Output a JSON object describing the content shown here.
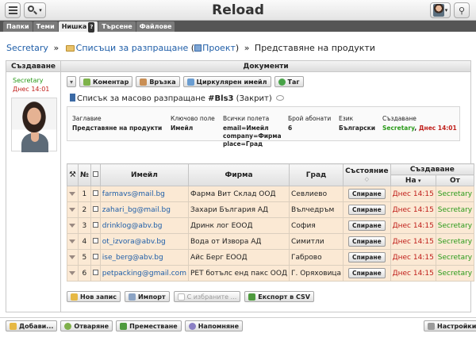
{
  "app": {
    "title": "Reload"
  },
  "tabs": [
    {
      "label": "Папки"
    },
    {
      "label": "Теми"
    },
    {
      "label": "Нишка",
      "badge": "?"
    },
    {
      "label": "Търсене"
    },
    {
      "label": "Файлове"
    }
  ],
  "breadcrumb": {
    "root": "Secretary",
    "sep1": "»",
    "lists": "Списъци за разпращане",
    "open_paren": " (",
    "project": "Проект",
    "close_paren": ")",
    "sep2": "»",
    "current": "Представяне на продукти"
  },
  "headers": {
    "left": "Създаване",
    "right": "Документи"
  },
  "author": {
    "name": "Secretary",
    "date": "Днес 14:01"
  },
  "actions": {
    "comment": "Коментар",
    "link": "Връзка",
    "circular": "Циркулярен имейл",
    "tag": "Таг"
  },
  "doc": {
    "title_prefix": "Списък за масово разпращане ",
    "code": "#Bls3",
    "status": " (Закрит)"
  },
  "info": {
    "labels": [
      "Заглавие",
      "Ключово поле",
      "Всички полета",
      "Брой абонати",
      "Език",
      "Създаване"
    ],
    "title": "Представяне на продукти",
    "key": "Имейл",
    "fields_1": "email=Имейл",
    "fields_2": "company=Фирма",
    "fields_3": "place=Град",
    "subscribers": "6",
    "language": "Български",
    "created_by": "Secretary",
    "created_sep": ", ",
    "created_date": "Днес 14:01"
  },
  "table": {
    "headers": {
      "num": "№",
      "email": "Имейл",
      "company": "Фирма",
      "city": "Град",
      "state": "Състояние",
      "created": "Създаване",
      "on": "На",
      "by": "От"
    },
    "rows": [
      {
        "num": "1",
        "email": "farmavs@mail.bg",
        "company": "Фарма Вит Склад ООД",
        "city": "Севлиево",
        "state": "Спиране",
        "on": "Днес 14:15",
        "by": "Secretary"
      },
      {
        "num": "2",
        "email": "zahari_bg@mail.bg",
        "company": "Захари България АД",
        "city": "Вълчедръм",
        "state": "Спиране",
        "on": "Днес 14:15",
        "by": "Secretary"
      },
      {
        "num": "3",
        "email": "drinklog@abv.bg",
        "company": "Дринк лог ЕООД",
        "city": "София",
        "state": "Спиране",
        "on": "Днес 14:15",
        "by": "Secretary"
      },
      {
        "num": "4",
        "email": "ot_izvora@abv.bg",
        "company": "Вода от Извора АД",
        "city": "Симитли",
        "state": "Спиране",
        "on": "Днес 14:15",
        "by": "Secretary"
      },
      {
        "num": "5",
        "email": "ise_berg@abv.bg",
        "company": "Айс Берг ЕООД",
        "city": "Габрово",
        "state": "Спиране",
        "on": "Днес 14:15",
        "by": "Secretary"
      },
      {
        "num": "6",
        "email": "petpacking@gmail.com",
        "company": "PET ботълс енд пакс ООД",
        "city": "Г. Оряховица",
        "state": "Спиране",
        "on": "Днес 14:15",
        "by": "Secretary"
      }
    ]
  },
  "list_actions": {
    "new": "Нов запис",
    "import": "Импорт",
    "selected": "С избраните ...",
    "export": "Експорт в CSV"
  },
  "bottom": {
    "add": "Добави...",
    "open": "Отваряне",
    "move": "Преместване",
    "remind": "Напомняне",
    "settings": "Настройки"
  },
  "colors": {
    "link": "#1f5ea8",
    "user": "#2a9a1a",
    "date": "#c0201c",
    "row": "#fbe9d4"
  }
}
